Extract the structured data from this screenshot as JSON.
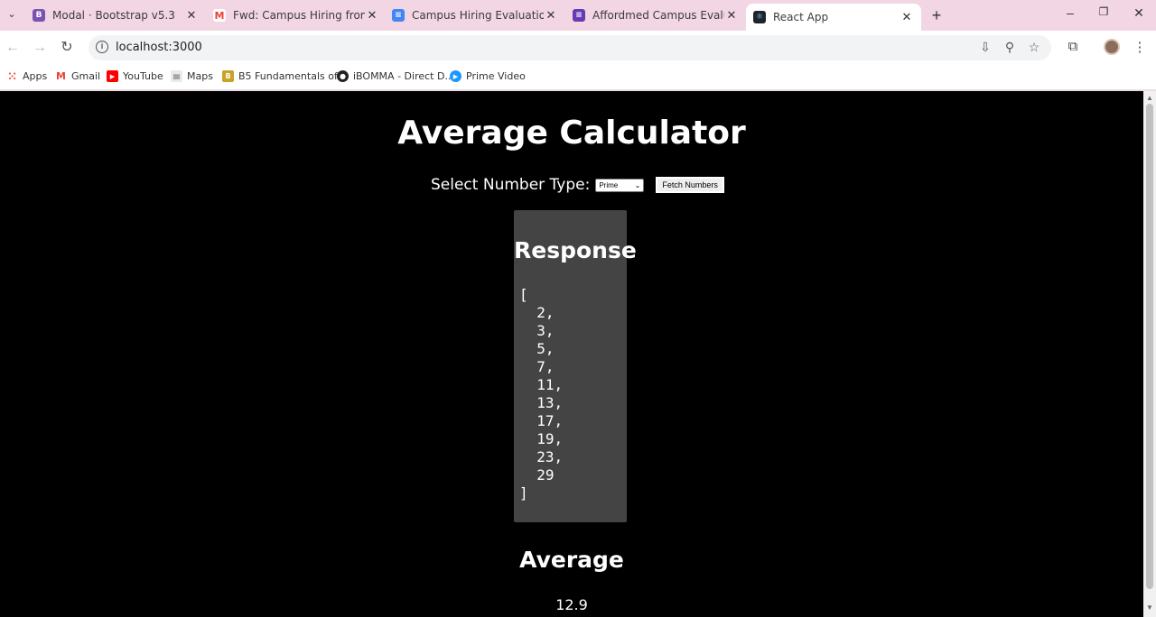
{
  "browser": {
    "tabs": [
      {
        "title": "Modal · Bootstrap v5.3",
        "icon": "bootstrap-icon",
        "color": "#7952b3"
      },
      {
        "title": "Fwd: Campus Hiring from DSU ...",
        "icon": "gmail-icon",
        "color": "#ea4335"
      },
      {
        "title": "Campus Hiring Evaluation - Fro...",
        "icon": "google-docs-icon",
        "color": "#4285f4"
      },
      {
        "title": "Affordmed Campus Evaluation ...",
        "icon": "google-forms-icon",
        "color": "#673ab7"
      },
      {
        "title": "React App",
        "icon": "react-icon",
        "color": "#20232a"
      }
    ],
    "url": "localhost:3000",
    "bookmarks": [
      {
        "label": "Apps",
        "icon": "apps-grid-icon"
      },
      {
        "label": "Gmail",
        "icon": "gmail-icon"
      },
      {
        "label": "YouTube",
        "icon": "youtube-icon"
      },
      {
        "label": "Maps",
        "icon": "maps-icon"
      },
      {
        "label": "B5 Fundamentals of...",
        "icon": "b5-icon"
      },
      {
        "label": "iBOMMA - Direct D...",
        "icon": "ibomma-icon"
      },
      {
        "label": "Prime Video",
        "icon": "prime-video-icon"
      }
    ]
  },
  "app": {
    "title": "Average Calculator",
    "select_label": "Select Number Type:",
    "select_value": "Prime",
    "fetch_label": "Fetch Numbers",
    "response_title": "Response",
    "response_json": "[\n  2,\n  3,\n  5,\n  7,\n  11,\n  13,\n  17,\n  19,\n  23,\n  29\n]",
    "average_title": "Average",
    "average_value": "12.9"
  }
}
